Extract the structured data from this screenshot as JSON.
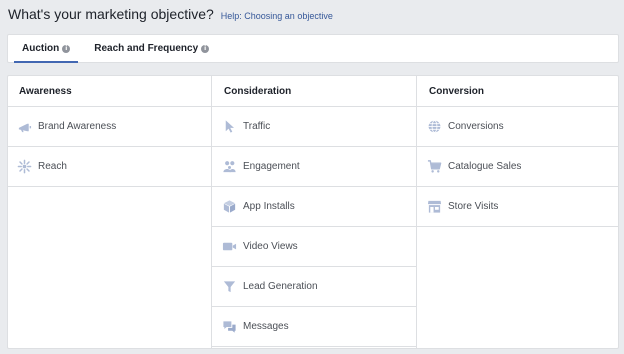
{
  "header": {
    "title": "What's your marketing objective?",
    "help_link": "Help: Choosing an objective"
  },
  "tabs": [
    {
      "label": "Auction",
      "active": true
    },
    {
      "label": "Reach and Frequency",
      "active": false
    }
  ],
  "columns": [
    {
      "title": "Awareness",
      "items": [
        {
          "label": "Brand Awareness",
          "icon": "megaphone-icon"
        },
        {
          "label": "Reach",
          "icon": "reach-icon"
        }
      ]
    },
    {
      "title": "Consideration",
      "items": [
        {
          "label": "Traffic",
          "icon": "cursor-icon"
        },
        {
          "label": "Engagement",
          "icon": "people-icon"
        },
        {
          "label": "App Installs",
          "icon": "box-icon"
        },
        {
          "label": "Video Views",
          "icon": "video-camera-icon"
        },
        {
          "label": "Lead Generation",
          "icon": "funnel-icon"
        },
        {
          "label": "Messages",
          "icon": "chat-bubbles-icon"
        }
      ]
    },
    {
      "title": "Conversion",
      "items": [
        {
          "label": "Conversions",
          "icon": "globe-icon"
        },
        {
          "label": "Catalogue Sales",
          "icon": "shopping-cart-icon"
        },
        {
          "label": "Store Visits",
          "icon": "storefront-icon"
        }
      ]
    }
  ],
  "colors": {
    "icon": "#aebbd6",
    "accent": "#4267b2",
    "link": "#365899",
    "border": "#dddfe2",
    "background": "#e9ebee"
  }
}
